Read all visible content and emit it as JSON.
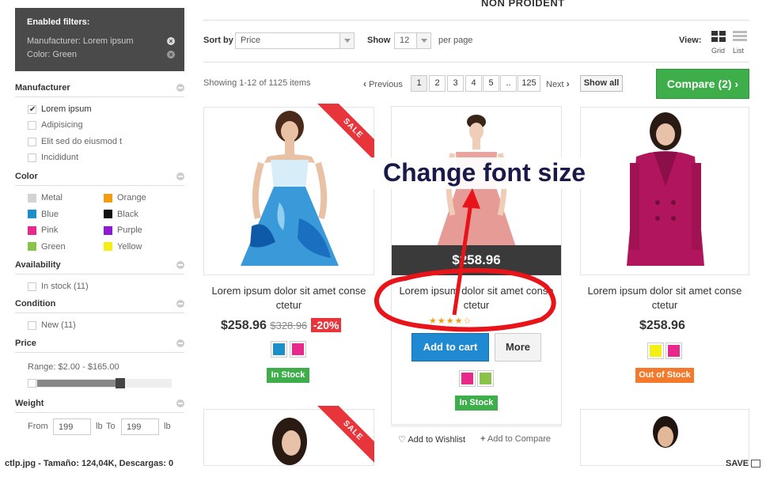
{
  "filters": {
    "title": "Enabled filters:",
    "items": [
      {
        "label": "Manufacturer: Lorem ipsum"
      },
      {
        "label": "Color: Green"
      }
    ]
  },
  "manufacturer": {
    "title": "Manufacturer",
    "options": [
      {
        "label": "Lorem ipsum",
        "checked": true
      },
      {
        "label": "Adipisicing",
        "checked": false
      },
      {
        "label": "Elit sed do eiusmod t",
        "checked": false
      },
      {
        "label": "Incididunt",
        "checked": false
      }
    ]
  },
  "color": {
    "title": "Color",
    "options": [
      {
        "label": "Metal",
        "hex": "#d3d3d3"
      },
      {
        "label": "Orange",
        "hex": "#f39c12"
      },
      {
        "label": "Blue",
        "hex": "#1a8fc9"
      },
      {
        "label": "Black",
        "hex": "#111111"
      },
      {
        "label": "Pink",
        "hex": "#e8288a"
      },
      {
        "label": "Purple",
        "hex": "#8e1ad6"
      },
      {
        "label": "Green",
        "hex": "#8bc34a"
      },
      {
        "label": "Yellow",
        "hex": "#f5ee14"
      }
    ]
  },
  "availability": {
    "title": "Availability",
    "option": "In stock (11)"
  },
  "condition": {
    "title": "Condition",
    "option": "New (11)"
  },
  "price": {
    "title": "Price",
    "range": "Range: $2.00 - $165.00",
    "slider_min_fraction": 0.07,
    "slider_max_fraction": 0.64
  },
  "weight": {
    "title": "Weight",
    "from_label": "From",
    "from_value": "199",
    "unit1": "lb",
    "to_label": "To",
    "to_value": "199",
    "unit2": "lb"
  },
  "top_title": "NON PROIDENT",
  "toolbar": {
    "sort_label": "Sort by",
    "sort_value": "Price",
    "show_label": "Show",
    "show_value": "12",
    "per_page": "per page",
    "view_label": "View:",
    "grid_label": "Grid",
    "list_label": "List"
  },
  "pager": {
    "showing": "Showing 1-12 of 1125 items",
    "prev": "Previous",
    "pages": [
      "1",
      "2",
      "3",
      "4",
      "5",
      "..",
      "125"
    ],
    "next": "Next",
    "show_all": "Show all",
    "compare": "Compare (2)"
  },
  "products": [
    {
      "name": "Lorem ipsum dolor sit amet conse ctetur",
      "price": "$258.96",
      "old_price": "$328.96",
      "discount": "-20%",
      "ribbon": "SALE",
      "swatches": [
        "#1a8fc9",
        "#e8288a"
      ],
      "stock": "In Stock"
    },
    {
      "name": "Lorem ipsum dolor sit amet conse ctetur",
      "price": "$258.96",
      "add_to_cart": "Add to cart",
      "more": "More",
      "swatches": [
        "#e8288a",
        "#8bc34a"
      ],
      "stock": "In Stock",
      "wishlist": "Add to Wishlist",
      "compare": "Add to Compare"
    },
    {
      "name": "Lorem ipsum dolor sit amet conse ctetur",
      "price": "$258.96",
      "swatches": [
        "#f5ee14",
        "#e8288a"
      ],
      "stock": "Out of Stock"
    },
    {
      "ribbon": "SALE"
    }
  ],
  "annotation": {
    "text": "Change font size",
    "color": "#e8141a"
  },
  "footer": {
    "left": "ctlp.jpg - Tamaño: 124,04K, Descargas: 0",
    "right": "SAVE"
  }
}
